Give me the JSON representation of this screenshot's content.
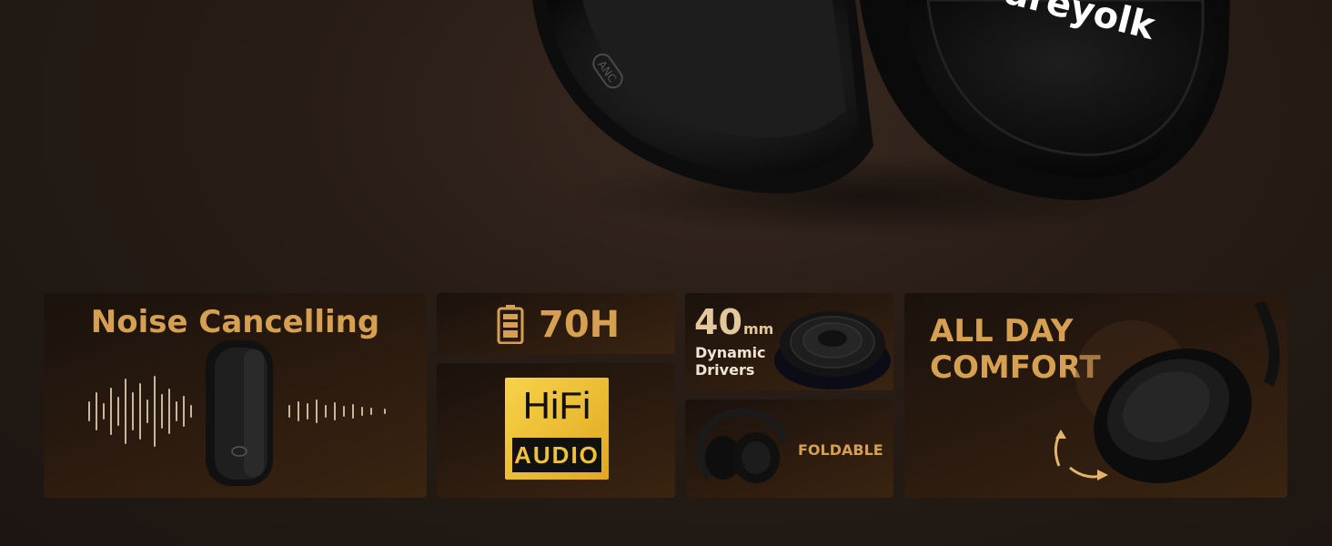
{
  "hero": {
    "brand": "areyolk",
    "button_label": "ANC"
  },
  "features": {
    "noise": {
      "title": "Noise Cancelling"
    },
    "battery": {
      "title": "70H",
      "icon": "battery-icon"
    },
    "hifi": {
      "top": "HiFi",
      "bottom": "AUDIO"
    },
    "driver": {
      "size": "40",
      "unit": "mm",
      "line1": "Dynamic",
      "line2": "Drivers"
    },
    "foldable": {
      "title": "FOLDABLE"
    },
    "comfort": {
      "line1": "ALL DAY",
      "line2": "COMFORT"
    }
  },
  "colors": {
    "gold": "#d6a052",
    "background": "#211913",
    "hifi_gold": "#f0c23c"
  }
}
